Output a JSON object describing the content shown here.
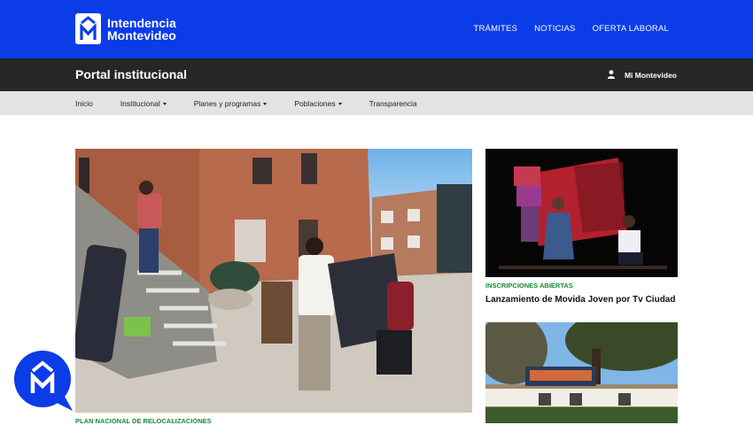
{
  "brand": {
    "line1": "Intendencia",
    "line2": "Montevideo"
  },
  "topnav": [
    {
      "label": "TRÁMITES"
    },
    {
      "label": "NOTICIAS"
    },
    {
      "label": "OFERTA LABORAL"
    }
  ],
  "portal": {
    "title": "Portal institucional",
    "account_label": "Mi Montevideo"
  },
  "subnav": [
    {
      "label": "Inicio"
    },
    {
      "label": "Institucional"
    },
    {
      "label": "Planes y programas"
    },
    {
      "label": "Poblaciones"
    },
    {
      "label": "Transparencia"
    }
  ],
  "featured": {
    "tag": "PLAN NACIONAL DE RELOCALIZACIONES"
  },
  "side_news": [
    {
      "tag": "INSCRIPCIONES ABIERTAS",
      "title": "Lanzamiento de Movida Joven por Tv Ciudad"
    }
  ],
  "colors": {
    "brand_blue": "#0b3ce8",
    "portal_bar": "#262626",
    "subnav_bg": "#e3e3e3",
    "tag_green": "#1a8a2e"
  },
  "icons": {
    "logo": "im-logo-icon",
    "user": "user-icon",
    "chat": "chat-assistant-icon"
  }
}
